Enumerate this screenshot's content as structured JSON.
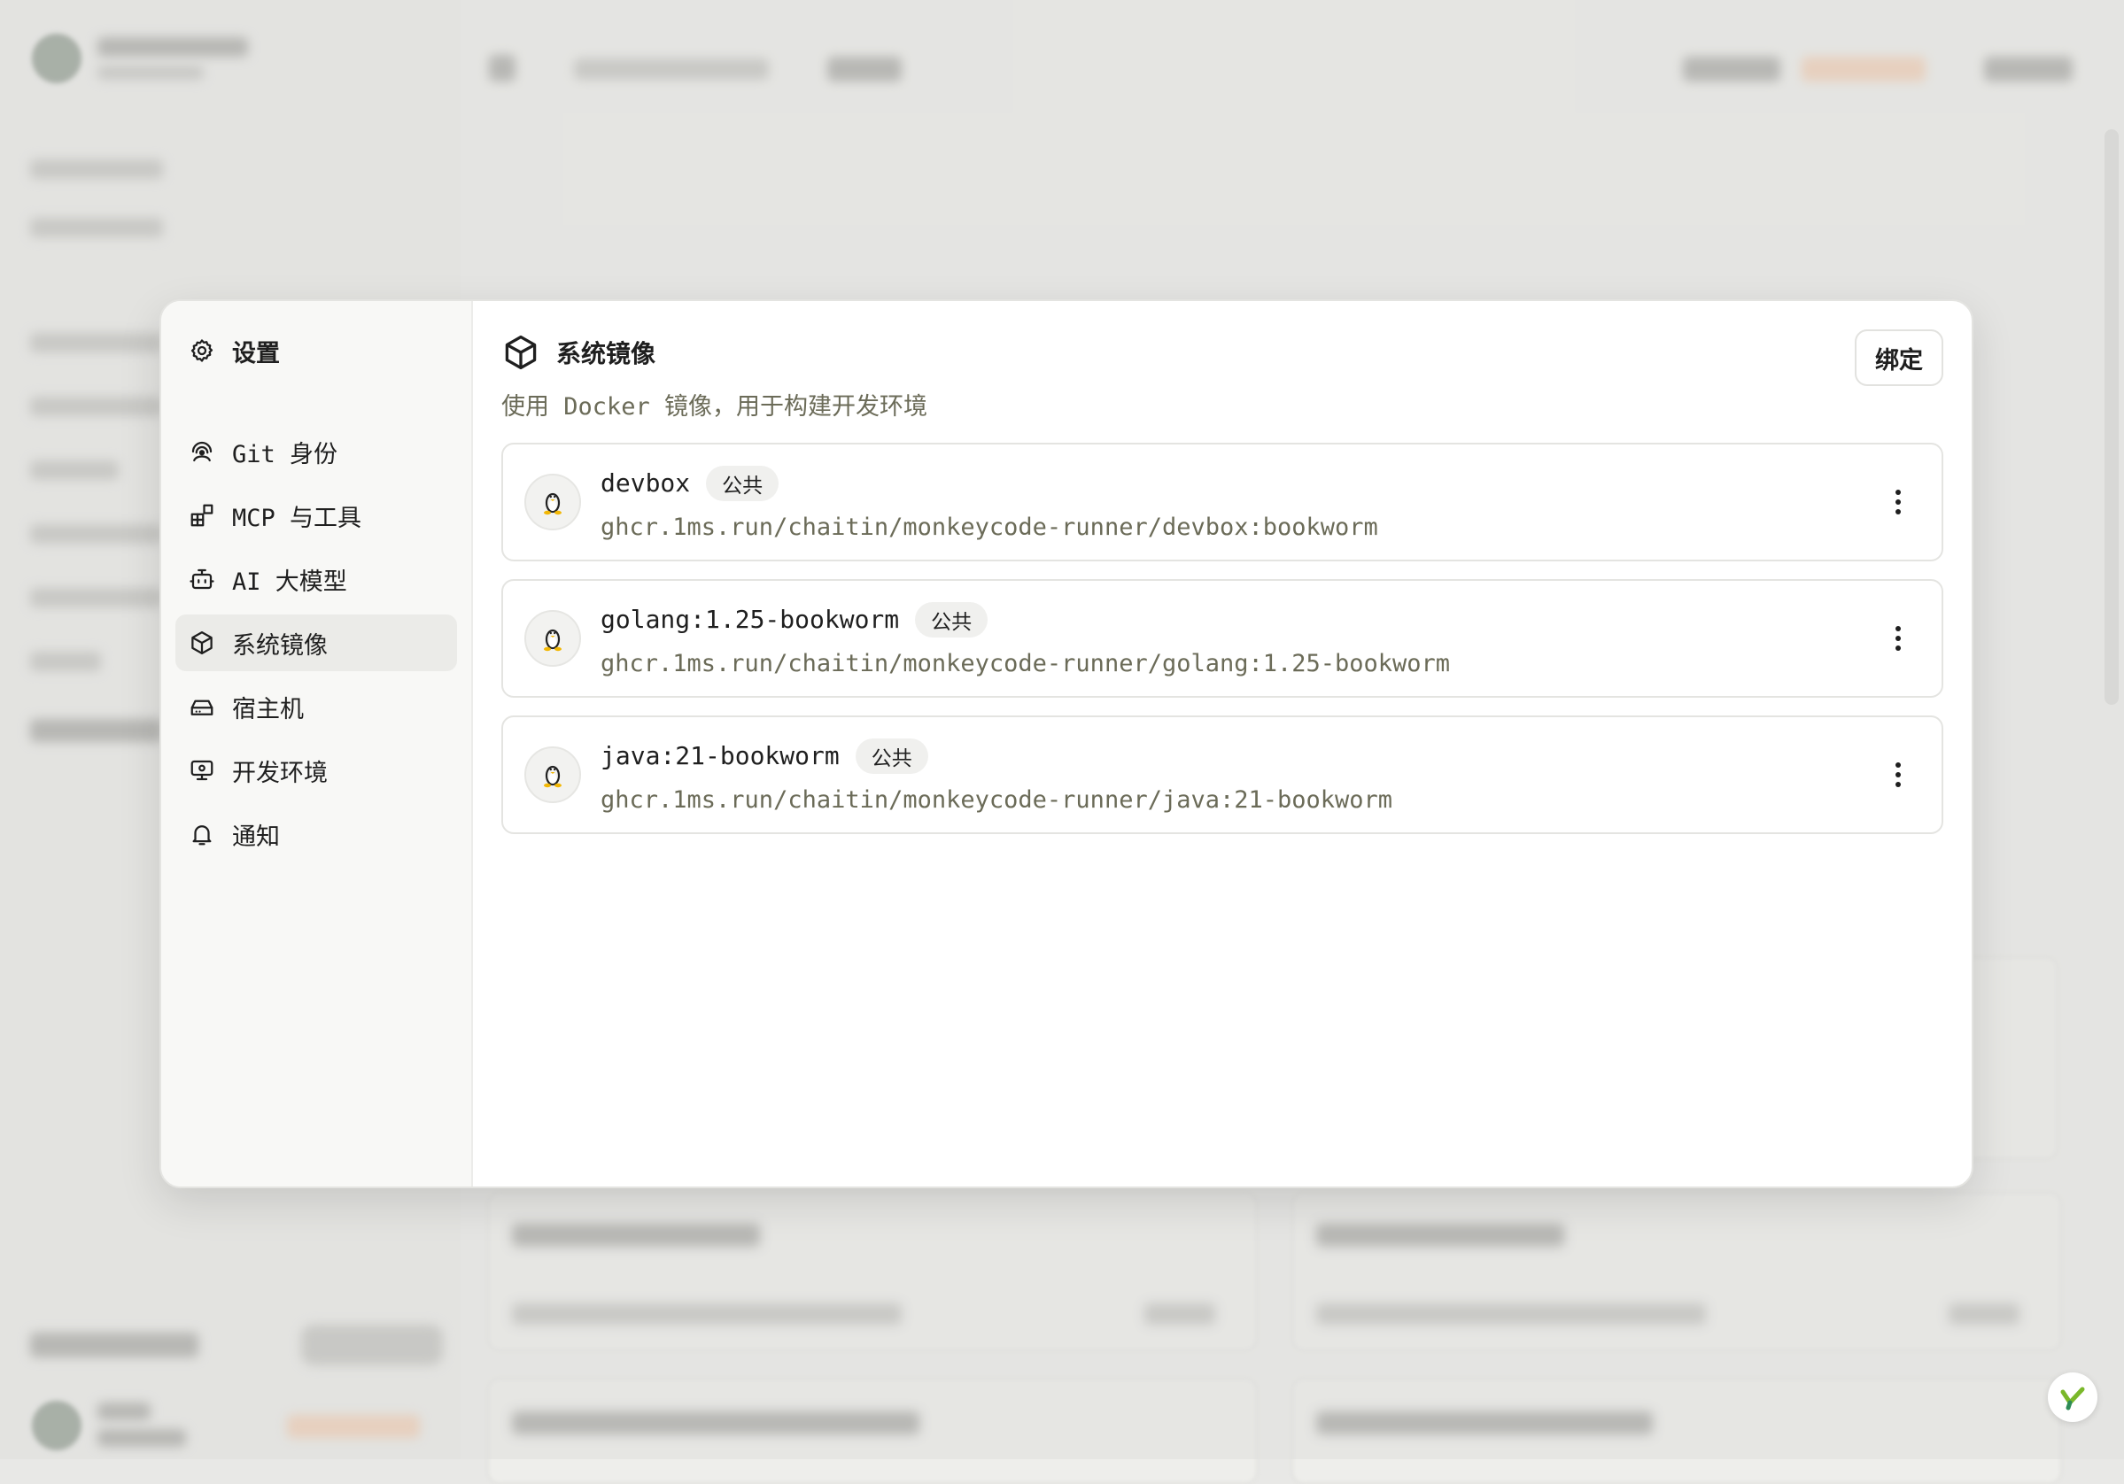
{
  "modal": {
    "nav_title": "设置",
    "nav_items": [
      {
        "label": "Git 身份",
        "icon": "git-identity-icon"
      },
      {
        "label": "MCP 与工具",
        "icon": "tools-icon"
      },
      {
        "label": "AI 大模型",
        "icon": "robot-icon"
      },
      {
        "label": "系统镜像",
        "icon": "box-icon",
        "active": true
      },
      {
        "label": "宿主机",
        "icon": "hard-drive-icon"
      },
      {
        "label": "开发环境",
        "icon": "monitor-icon"
      },
      {
        "label": "通知",
        "icon": "bell-icon"
      }
    ],
    "section_title": "系统镜像",
    "section_subtitle": "使用 Docker 镜像，用于构建开发环境",
    "bind_label": "绑定",
    "images": [
      {
        "name": "devbox",
        "badge": "公共",
        "path": "ghcr.1ms.run/chaitin/monkeycode-runner/devbox:bookworm",
        "os_icon": "linux-penguin-icon"
      },
      {
        "name": "golang:1.25-bookworm",
        "badge": "公共",
        "path": "ghcr.1ms.run/chaitin/monkeycode-runner/golang:1.25-bookworm",
        "os_icon": "linux-penguin-icon"
      },
      {
        "name": "java:21-bookworm",
        "badge": "公共",
        "path": "ghcr.1ms.run/chaitin/monkeycode-runner/java:21-bookworm",
        "os_icon": "linux-penguin-icon"
      }
    ]
  },
  "colors": {
    "text_primary": "#1f1f1f",
    "text_muted": "#6b6b58",
    "nav_active_bg": "#ebebe8",
    "badge_bg": "#f0f0ee",
    "brand_green": "#7ab82a"
  }
}
